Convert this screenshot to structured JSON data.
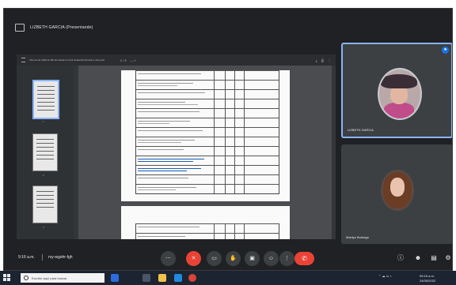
{
  "presenter": {
    "label": "LIZBETH GARCIA (Presentando)"
  },
  "pdf_viewer": {
    "filename": "Informe de 2022 de Mb Ec Gobierno Civil Ciudad Perimetral y otros.pdf",
    "page_indicator": "1 / 3",
    "zoom_controls": "—  +",
    "thumbnail_numbers": [
      "1",
      "2",
      "3"
    ]
  },
  "participants": [
    {
      "name": "LIZBETH GARCIA",
      "pinned": true
    },
    {
      "name": "Marilyn Buitrago",
      "pinned": false
    }
  ],
  "meet_bar": {
    "time": "9:16 a.m.",
    "separator": "|",
    "meeting_code": "rvy-wgohr-fgh"
  },
  "taskbar": {
    "search_placeholder": "Escribe aquí para buscar",
    "tray_time": "09:16 a.m.",
    "tray_date": "24/05/2022"
  },
  "colors": {
    "accent": "#8ab4f8",
    "end_call": "#ea4335",
    "background": "#202124"
  },
  "icons": [
    "share-screen-icon",
    "mic-off-icon",
    "camera-off-icon",
    "captions-icon",
    "raise-hand-icon",
    "present-icon",
    "more-icon",
    "end-call-icon",
    "info-icon",
    "people-icon",
    "chat-icon",
    "activities-icon"
  ]
}
